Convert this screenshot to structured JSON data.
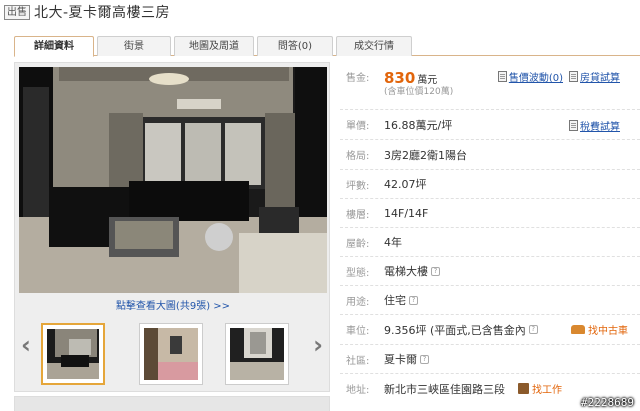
{
  "header": {
    "badge": "出售",
    "title": "北大-夏卡爾高樓三房"
  },
  "tabs": [
    {
      "label": "詳細資料"
    },
    {
      "label": "街景"
    },
    {
      "label": "地圖及周道"
    },
    {
      "label": "問答(0)"
    },
    {
      "label": "成交行情"
    }
  ],
  "gallery": {
    "link_text": "點擊查看大圖(共9張) >>",
    "prev_label": "‹",
    "next_label": "›"
  },
  "details": {
    "price": {
      "label": "售金:",
      "value": "830",
      "unit": "萬元",
      "note": "(含車位價120萬)"
    },
    "price_links": {
      "history": "售價波動(0)",
      "loan": "房貸試算"
    },
    "unit_price": {
      "label": "單價:",
      "value": "16.88萬元/坪"
    },
    "tax_link": "稅費試算",
    "layout": {
      "label": "格局:",
      "value": "3房2廳2衛1陽台"
    },
    "area": {
      "label": "坪數:",
      "value": "42.07坪"
    },
    "floor": {
      "label": "樓層:",
      "value": "14F/14F"
    },
    "age": {
      "label": "屋齡:",
      "value": "4年"
    },
    "type": {
      "label": "型態:",
      "value": "電梯大樓"
    },
    "usage": {
      "label": "用途:",
      "value": "住宅"
    },
    "parking": {
      "label": "車位:",
      "value": "9.356坪 (平面式,已含售金內"
    },
    "car_link": "找中古車",
    "community": {
      "label": "社區:",
      "value": "夏卡爾"
    },
    "address": {
      "label": "地址:",
      "value": "新北市三峽區佳園路三段"
    },
    "work_link": "找工作"
  },
  "watermark": "#2228689"
}
